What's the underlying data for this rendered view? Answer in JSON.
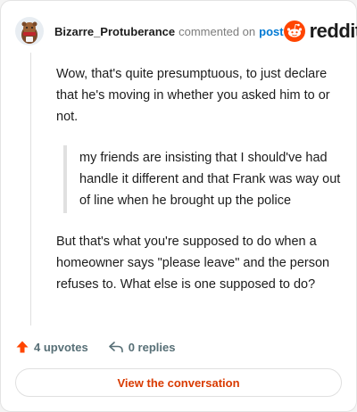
{
  "comment": {
    "username": "Bizarre_Protuberance",
    "action_text": "commented on",
    "post_link": "post",
    "brand": "reddit",
    "paragraph_1": "Wow, that's quite presumptuous, to just declare that he's moving in whether you asked him to or not.",
    "quote": "my friends are insisting that I should've had handle it different and that Frank was way out of line when he brought up the police",
    "paragraph_2": "But that's what you're supposed to do when a homeowner says \"please leave\" and the person refuses to. What else is one supposed to do?"
  },
  "footer": {
    "upvotes": "4 upvotes",
    "replies": "0 replies",
    "view_button": "View the conversation"
  },
  "colors": {
    "accent": "#ff4500",
    "link": "#0079d3",
    "button_text": "#d93a00"
  },
  "icons": [
    "avatar-icon",
    "reddit-logo-icon",
    "upvote-arrow-icon",
    "reply-icon"
  ]
}
